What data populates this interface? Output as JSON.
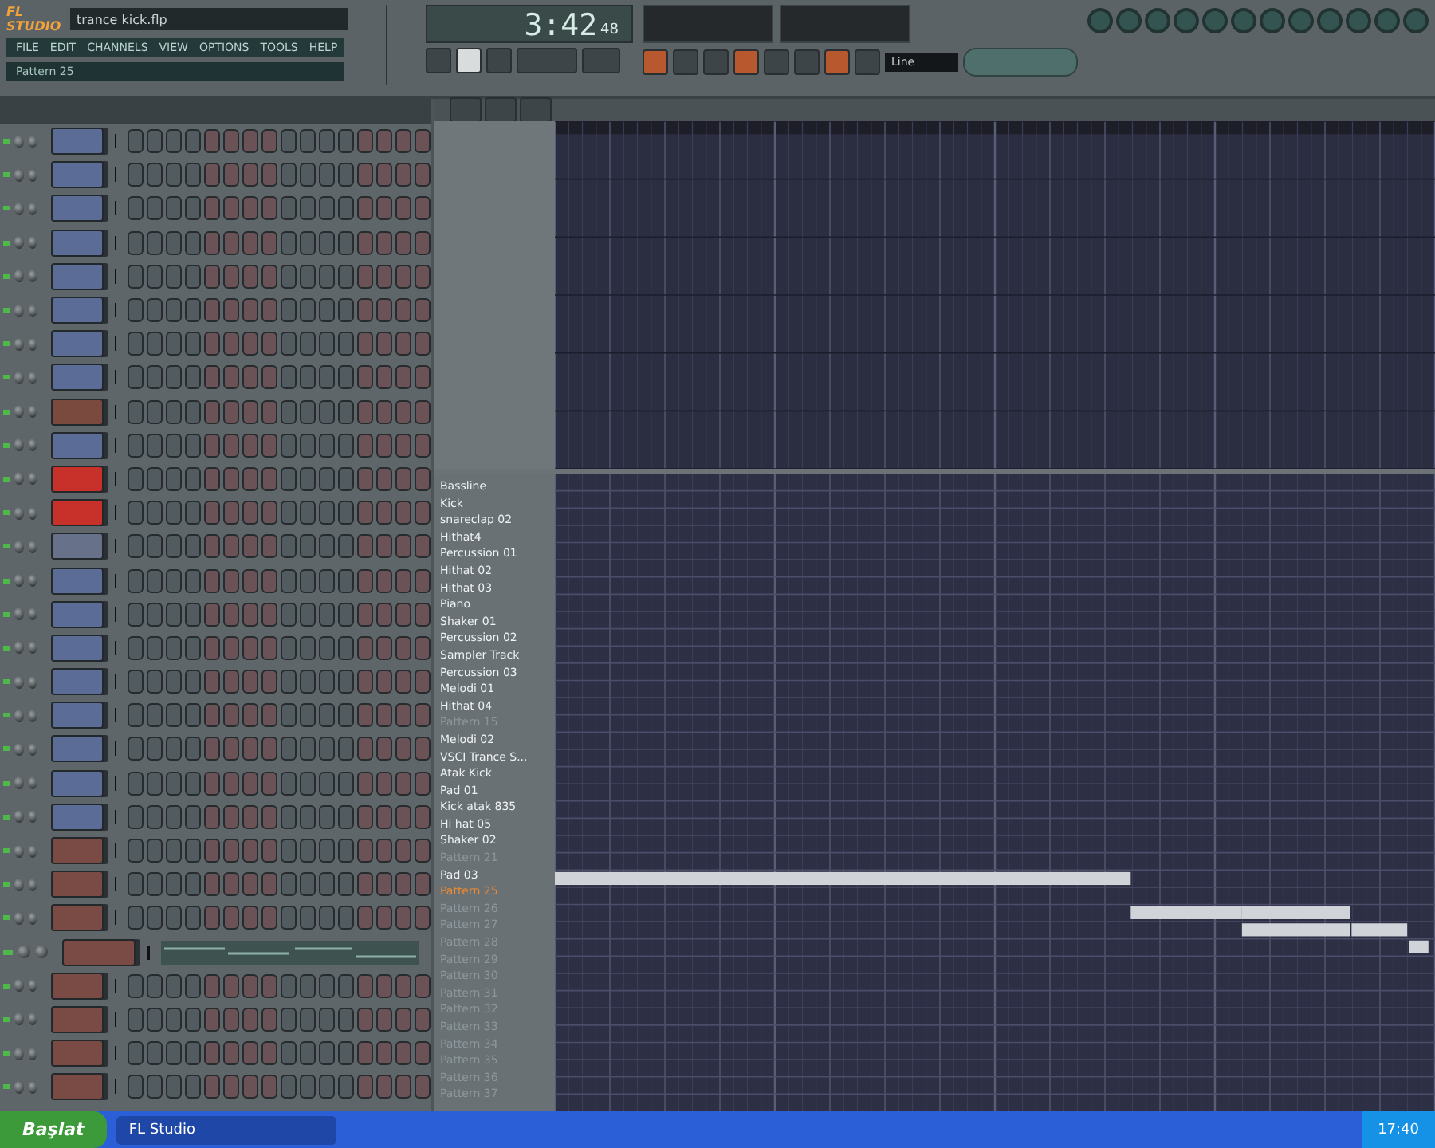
{
  "window": {
    "logo": "FL STUDIO",
    "file_name": "trance kick.flp"
  },
  "menu": [
    "FILE",
    "EDIT",
    "CHANNELS",
    "VIEW",
    "OPTIONS",
    "TOOLS",
    "HELP"
  ],
  "pattern_selector": {
    "value": "Pattern 25"
  },
  "clock": {
    "main": "3:42",
    "sub": "48"
  },
  "snap": {
    "value": "Line"
  },
  "channels": [
    {
      "color": "#5b6c96",
      "kind": "steps"
    },
    {
      "color": "#5b6c96",
      "kind": "steps"
    },
    {
      "color": "#5b6c96",
      "kind": "steps"
    },
    {
      "color": "#5b6c96",
      "kind": "steps"
    },
    {
      "color": "#5b6c96",
      "kind": "steps"
    },
    {
      "color": "#5b6c96",
      "kind": "steps"
    },
    {
      "color": "#5b6c96",
      "kind": "steps"
    },
    {
      "color": "#5b6c96",
      "kind": "steps"
    },
    {
      "color": "#7a4a3e",
      "kind": "steps"
    },
    {
      "color": "#5b6c96",
      "kind": "steps"
    },
    {
      "color": "#c8302a",
      "kind": "steps"
    },
    {
      "color": "#c8302a",
      "kind": "steps"
    },
    {
      "color": "#68718a",
      "kind": "steps"
    },
    {
      "color": "#5b6c96",
      "kind": "steps"
    },
    {
      "color": "#5b6c96",
      "kind": "steps"
    },
    {
      "color": "#5b6c96",
      "kind": "steps"
    },
    {
      "color": "#5b6c96",
      "kind": "steps"
    },
    {
      "color": "#5b6c96",
      "kind": "steps"
    },
    {
      "color": "#5b6c96",
      "kind": "steps"
    },
    {
      "color": "#5b6c96",
      "kind": "steps"
    },
    {
      "color": "#5b6c96",
      "kind": "steps"
    },
    {
      "color": "#7a4a44",
      "kind": "steps"
    },
    {
      "color": "#7a4a44",
      "kind": "steps"
    },
    {
      "color": "#7a4a44",
      "kind": "steps"
    },
    {
      "color": "#7a4a44",
      "kind": "roll"
    },
    {
      "color": "#7a4a44",
      "kind": "steps"
    },
    {
      "color": "#7a4a44",
      "kind": "steps"
    },
    {
      "color": "#7a4a44",
      "kind": "steps"
    },
    {
      "color": "#7a4a44",
      "kind": "steps"
    }
  ],
  "tracks": [
    {
      "name": "Bassline",
      "kind": "used"
    },
    {
      "name": "Kick",
      "kind": "used"
    },
    {
      "name": "snareclap 02",
      "kind": "used"
    },
    {
      "name": "Hithat4",
      "kind": "used"
    },
    {
      "name": "Percussion 01",
      "kind": "used"
    },
    {
      "name": "Hithat 02",
      "kind": "used"
    },
    {
      "name": "Hithat 03",
      "kind": "used"
    },
    {
      "name": "Piano",
      "kind": "used"
    },
    {
      "name": "Shaker 01",
      "kind": "used"
    },
    {
      "name": "Percussion 02",
      "kind": "used"
    },
    {
      "name": "Sampler Track",
      "kind": "used"
    },
    {
      "name": "Percussion 03",
      "kind": "used"
    },
    {
      "name": "Melodi 01",
      "kind": "used"
    },
    {
      "name": "Hithat 04",
      "kind": "used"
    },
    {
      "name": "Pattern 15",
      "kind": "empty"
    },
    {
      "name": "Melodi 02",
      "kind": "used"
    },
    {
      "name": "VSCI Trance S...",
      "kind": "used"
    },
    {
      "name": "Atak Kick",
      "kind": "used"
    },
    {
      "name": "Pad 01",
      "kind": "used"
    },
    {
      "name": "Kick atak 835",
      "kind": "used"
    },
    {
      "name": "Hi hat 05",
      "kind": "used"
    },
    {
      "name": "Shaker 02",
      "kind": "used"
    },
    {
      "name": "Pattern 21",
      "kind": "empty"
    },
    {
      "name": "Pad 03",
      "kind": "used"
    },
    {
      "name": "Pattern 25",
      "kind": "current"
    },
    {
      "name": "Pattern 26",
      "kind": "empty"
    },
    {
      "name": "Pattern 27",
      "kind": "empty"
    },
    {
      "name": "Pattern 28",
      "kind": "empty"
    },
    {
      "name": "Pattern 29",
      "kind": "empty"
    },
    {
      "name": "Pattern 30",
      "kind": "empty"
    },
    {
      "name": "Pattern 31",
      "kind": "empty"
    },
    {
      "name": "Pattern 32",
      "kind": "empty"
    },
    {
      "name": "Pattern 33",
      "kind": "empty"
    },
    {
      "name": "Pattern 34",
      "kind": "empty"
    },
    {
      "name": "Pattern 35",
      "kind": "empty"
    },
    {
      "name": "Pattern 36",
      "kind": "empty"
    },
    {
      "name": "Pattern 37",
      "kind": "empty"
    }
  ],
  "taskbar": {
    "start": "Başlat",
    "tasks": [
      {
        "label": "FL Studio",
        "selected": true
      }
    ],
    "time": "17:40"
  }
}
